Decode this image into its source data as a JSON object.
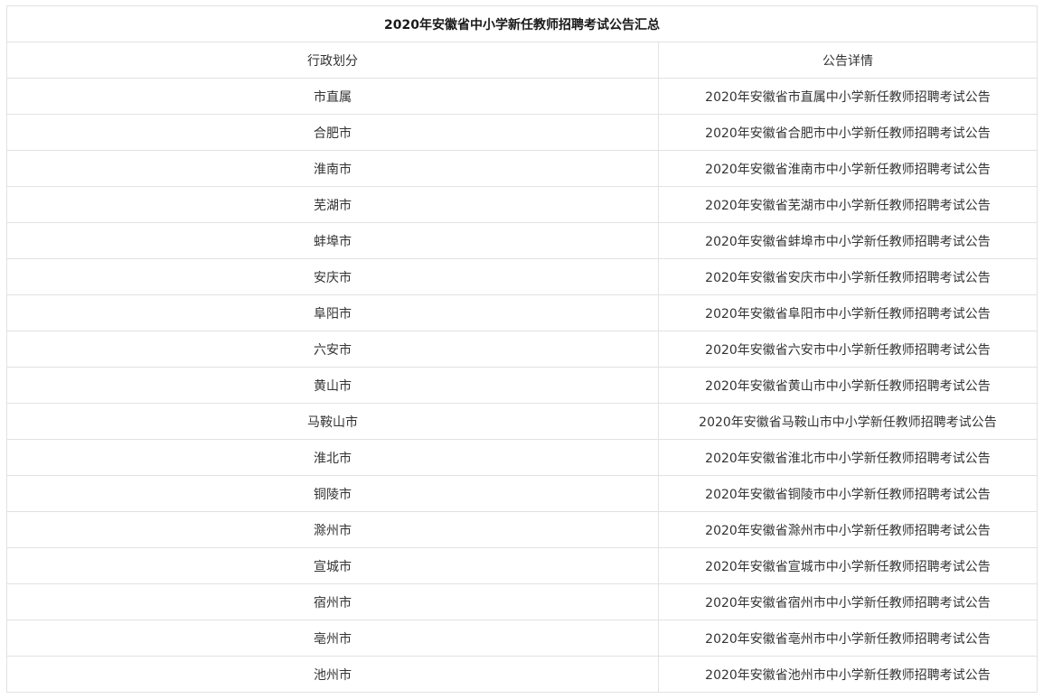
{
  "table": {
    "title": "2020年安徽省中小学新任教师招聘考试公告汇总",
    "headers": [
      "行政划分",
      "公告详情"
    ],
    "rows": [
      {
        "region": "市直属",
        "notice": "2020年安徽省市直属中小学新任教师招聘考试公告"
      },
      {
        "region": "合肥市",
        "notice": "2020年安徽省合肥市中小学新任教师招聘考试公告"
      },
      {
        "region": "淮南市",
        "notice": "2020年安徽省淮南市中小学新任教师招聘考试公告"
      },
      {
        "region": "芜湖市",
        "notice": "2020年安徽省芜湖市中小学新任教师招聘考试公告"
      },
      {
        "region": "蚌埠市",
        "notice": "2020年安徽省蚌埠市中小学新任教师招聘考试公告"
      },
      {
        "region": "安庆市",
        "notice": "2020年安徽省安庆市中小学新任教师招聘考试公告"
      },
      {
        "region": "阜阳市",
        "notice": "2020年安徽省阜阳市中小学新任教师招聘考试公告"
      },
      {
        "region": "六安市",
        "notice": "2020年安徽省六安市中小学新任教师招聘考试公告"
      },
      {
        "region": "黄山市",
        "notice": "2020年安徽省黄山市中小学新任教师招聘考试公告"
      },
      {
        "region": "马鞍山市",
        "notice": "2020年安徽省马鞍山市中小学新任教师招聘考试公告"
      },
      {
        "region": "淮北市",
        "notice": "2020年安徽省淮北市中小学新任教师招聘考试公告"
      },
      {
        "region": "铜陵市",
        "notice": "2020年安徽省铜陵市中小学新任教师招聘考试公告"
      },
      {
        "region": "滁州市",
        "notice": "2020年安徽省滁州市中小学新任教师招聘考试公告"
      },
      {
        "region": "宣城市",
        "notice": "2020年安徽省宣城市中小学新任教师招聘考试公告"
      },
      {
        "region": "宿州市",
        "notice": "2020年安徽省宿州市中小学新任教师招聘考试公告"
      },
      {
        "region": "亳州市",
        "notice": "2020年安徽省亳州市中小学新任教师招聘考试公告"
      },
      {
        "region": "池州市",
        "notice": "2020年安徽省池州市中小学新任教师招聘考试公告"
      }
    ]
  }
}
